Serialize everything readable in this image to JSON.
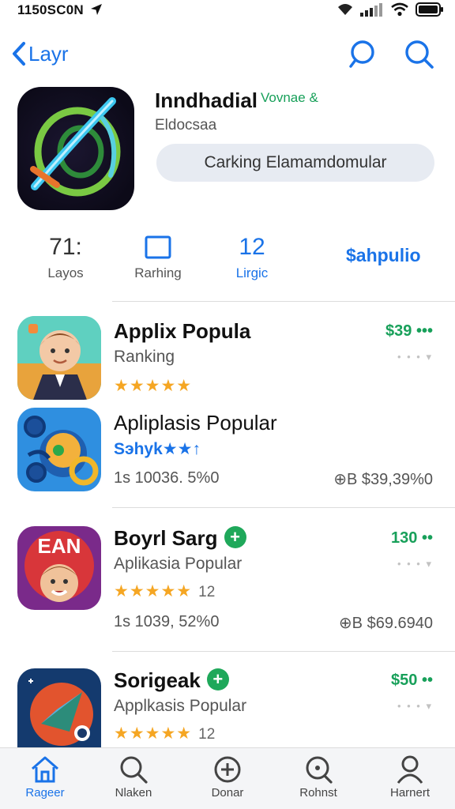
{
  "status_bar": {
    "time": "1150SC0N"
  },
  "nav": {
    "back_label": "Layr"
  },
  "hero": {
    "title": "Inndhadial",
    "badge": "Vovnae &",
    "subtitle": "Eldocsaa",
    "pill_label": "Carking Elamamdomular"
  },
  "tabs": [
    {
      "big": "71:",
      "label": "Layos"
    },
    {
      "big": "",
      "label": "Rarhing"
    },
    {
      "big": "12",
      "label": "Lirgic"
    }
  ],
  "tabs_link": "$ahpulio",
  "apps": [
    {
      "title": "Applix Popula",
      "subtitle": "Ranking",
      "rating": "★★★★★",
      "price": "$39",
      "price_dots": "•••",
      "dots": "• • • ▾"
    },
    {
      "title": "Apliplasis Popular",
      "rating_text": "Sэhyk★★↑",
      "meta": "1s 10036. 5%0",
      "size": "⊕B $39,39%0"
    },
    {
      "title": "Boyrl Sarg",
      "add": "+",
      "subtitle": "Aplikasia Popular",
      "rating": "★★★★★",
      "rating_count": "12",
      "price": "130",
      "price_dots": "••",
      "dots": "• • • ▾",
      "meta": "1s 1039, 52%0",
      "size": "⊕B $69.6940"
    },
    {
      "title": "Sorigeak",
      "add": "+",
      "subtitle": "Applkasis Popular",
      "rating": "★★★★★",
      "rating_count": "12",
      "price": "$50",
      "price_dots": "••",
      "dots": "• • • ▾"
    }
  ],
  "tabbar": [
    {
      "label": "Rageer",
      "icon": "home-icon"
    },
    {
      "label": "Nlaken",
      "icon": "search-icon"
    },
    {
      "label": "Donar",
      "icon": "plus-circle-icon"
    },
    {
      "label": "Rohnst",
      "icon": "search-alt-icon"
    },
    {
      "label": "Harnert",
      "icon": "person-icon"
    }
  ],
  "colors": {
    "accent": "#1a73e8",
    "price": "#18a05a",
    "star": "#f5a623",
    "pill": "#e7ebf2"
  }
}
